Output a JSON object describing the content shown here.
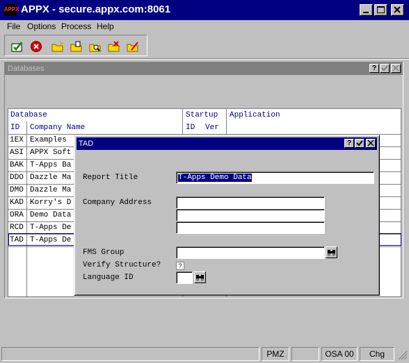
{
  "window": {
    "title": "APPX - secure.appx.com:8061",
    "icon_text": "APPX"
  },
  "menu": [
    "File",
    "Options",
    "Process",
    "Help"
  ],
  "toolbar": [
    "ok-check-icon",
    "cancel-x-icon",
    "folder-new-icon",
    "folder-open-icon",
    "folder-search-icon",
    "folder-cancel-icon",
    "folder-edit-icon"
  ],
  "child_window": {
    "title": "Databases",
    "help": "?"
  },
  "grid": {
    "group_headers": {
      "database": "Database",
      "startup": "Startup",
      "application": "Application"
    },
    "col_headers": {
      "id": "ID",
      "company": "Company Name",
      "startup_id": "ID",
      "startup_ver": "Ver"
    },
    "rows": [
      {
        "id": "1EX",
        "company": "Examples"
      },
      {
        "id": "ASI",
        "company": "APPX Soft"
      },
      {
        "id": "BAK",
        "company": "T-Apps Ba"
      },
      {
        "id": "DDO",
        "company": "Dazzle Ma"
      },
      {
        "id": "DMO",
        "company": "Dazzle Ma"
      },
      {
        "id": "KAD",
        "company": "Korry's D"
      },
      {
        "id": "ORA",
        "company": "Demo Data"
      },
      {
        "id": "RCD",
        "company": "T-Apps De"
      },
      {
        "id": "TAD",
        "company": "T-Apps De"
      }
    ]
  },
  "dialog": {
    "title": "TAD",
    "help": "?",
    "report_title_label": "Report Title",
    "report_title_value": "T-Apps Demo Data",
    "company_address_label": "Company Address",
    "address_lines": [
      "",
      "",
      ""
    ],
    "fms_group_label": "FMS Group",
    "fms_group_value": "",
    "verify_label": "Verify Structure?",
    "verify_value": "?",
    "language_label": "Language ID",
    "language_value": ""
  },
  "status": {
    "p1": "PMZ",
    "p2": "",
    "p3": "OSA 00",
    "p4": "Chg"
  }
}
